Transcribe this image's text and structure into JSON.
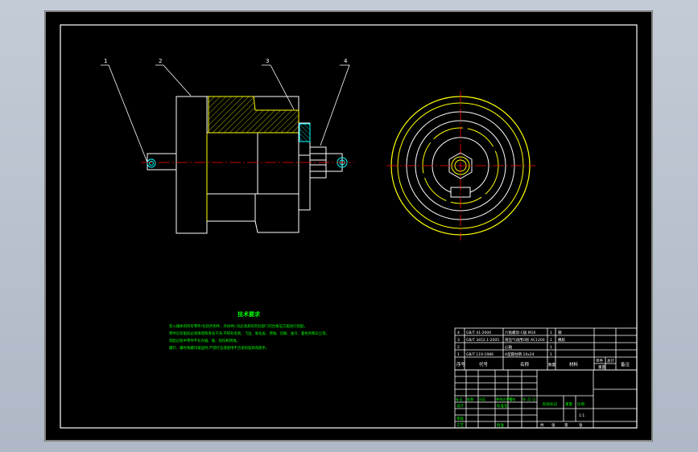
{
  "colors": {
    "background": "#000000",
    "frame": "#ffffff",
    "outline": "#ffff00",
    "centerline": "#ff0000",
    "hatch": "#ffff00",
    "seal": "#00ffff",
    "notes": "#00ff00",
    "window": "#b7c0cc"
  },
  "balloons": [
    "1",
    "2",
    "3",
    "4"
  ],
  "notes": {
    "title": "技术要求",
    "lines": [
      "装入箱体的所有零件(包括外购件、外协件),均必须具有检验部门的合格证方能进行装配。",
      "零件在装配前必须清理和清洗干净,不得有毛刺、飞边、氧化皮、锈蚀、切屑、油污、着色剂和灰尘等。",
      "装配过程中零件不允许磕、碰、划伤和锈蚀。",
      "螺钉、螺栓和螺母紧固时,严禁打击或使用不合适的旋具和扳手。"
    ]
  },
  "bom": {
    "rows": [
      [
        "4",
        "GB/T 41-2000",
        "六角螺母-C级 M10",
        "1",
        "钢"
      ],
      [
        "3",
        "GB/T 3452.1-2005",
        "液压气动用O形 AC1200",
        "1",
        "橡胶"
      ],
      [
        "2",
        "",
        "心轴",
        "1",
        ""
      ],
      [
        "1",
        "GB/T 119-1986",
        "A型圆柱销 10x24",
        "1",
        ""
      ]
    ],
    "header": {
      "seq": "序号",
      "code": "代号",
      "name": "名称",
      "qty": "数量",
      "material": "材料",
      "unit_weight": "单件",
      "total_weight": "总计",
      "weight": "重量",
      "remark": "备注"
    }
  },
  "title_block": {
    "row_labels": [
      "标记",
      "处数",
      "分区",
      "更改文件号",
      "签名",
      "年",
      "月",
      "日"
    ],
    "design": "设计",
    "standard": "标准化",
    "stage": "阶段标记",
    "weight": "重量",
    "scale": "比例",
    "scale_value": "1:1",
    "review": "审核",
    "process": "工艺",
    "approve": "批准",
    "sheets": [
      "共",
      "张",
      "第",
      "张"
    ]
  }
}
